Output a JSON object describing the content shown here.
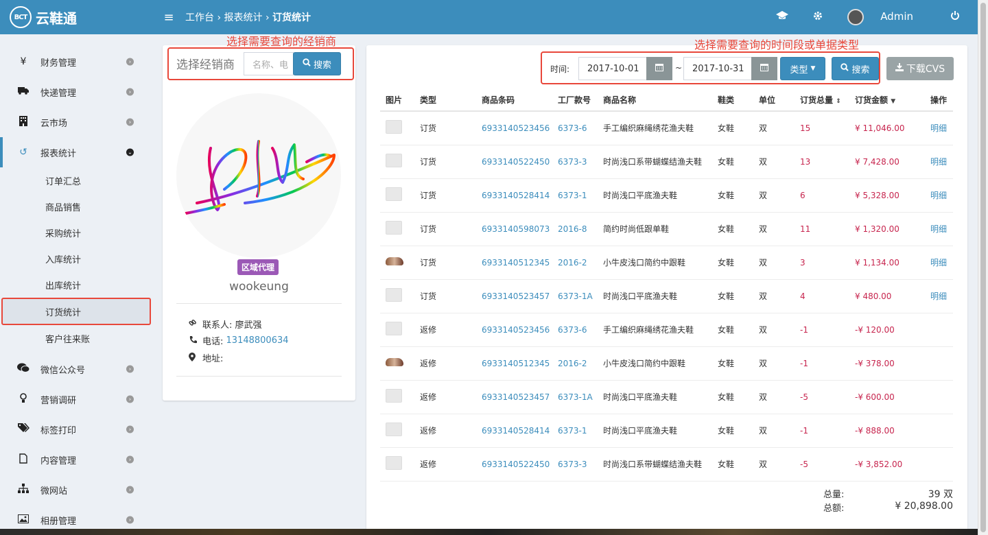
{
  "app": {
    "logo_text": "BCT",
    "name": "云鞋通"
  },
  "topbar": {
    "breadcrumb": [
      "工作台",
      "报表统计",
      "订货统计"
    ],
    "user": "Admin"
  },
  "sidebar": {
    "items": [
      {
        "label": "财务管理",
        "icon": "yen-icon"
      },
      {
        "label": "快递管理",
        "icon": "truck-icon"
      },
      {
        "label": "云市场",
        "icon": "building-icon"
      },
      {
        "label": "报表统计",
        "icon": "history-icon"
      }
    ],
    "sub_items": [
      "订单汇总",
      "商品销售",
      "采购统计",
      "入库统计",
      "出库统计",
      "订货统计",
      "客户往来账"
    ],
    "lower_items": [
      {
        "label": "微信公众号",
        "icon": "wechat-icon"
      },
      {
        "label": "营销调研",
        "icon": "bulb-icon"
      },
      {
        "label": "标签打印",
        "icon": "tags-icon"
      },
      {
        "label": "内容管理",
        "icon": "file-icon"
      },
      {
        "label": "微网站",
        "icon": "sitemap-icon"
      },
      {
        "label": "相册管理",
        "icon": "image-icon"
      }
    ]
  },
  "annotations": {
    "left": "选择需要查询的经销商",
    "right": "选择需要查询的时间段或单据类型"
  },
  "dealer": {
    "label": "选择经销商",
    "search_placeholder": "名称、电",
    "search_button": "搜索",
    "badge": "区域代理",
    "name": "wookeung",
    "contact_label": "联系人:",
    "contact": "廖武强",
    "phone_label": "电话:",
    "phone": "13148800634",
    "address_label": "地址:"
  },
  "filters": {
    "time_label": "时间:",
    "date_from": "2017-10-01",
    "sep": "~",
    "date_to": "2017-10-31",
    "type_button": "类型",
    "search_button": "搜索",
    "download_button": "下载CVS"
  },
  "table": {
    "headers": [
      "图片",
      "类型",
      "商品条码",
      "工厂款号",
      "商品名称",
      "鞋类",
      "单位",
      "订货总量",
      "订货金额",
      "操作"
    ],
    "rows": [
      {
        "img": "placeholder",
        "type": "订货",
        "barcode": "6933140523456",
        "style": "6373-6",
        "name": "手工编织麻绳绣花渔夫鞋",
        "category": "女鞋",
        "unit": "双",
        "qty": "15",
        "amount": "¥ 11,046.00",
        "op": "明细"
      },
      {
        "img": "placeholder",
        "type": "订货",
        "barcode": "6933140522450",
        "style": "6373-3",
        "name": "时尚浅口系带蝴蝶结渔夫鞋",
        "category": "女鞋",
        "unit": "双",
        "qty": "13",
        "amount": "¥ 7,428.00",
        "op": "明细"
      },
      {
        "img": "placeholder",
        "type": "订货",
        "barcode": "6933140528414",
        "style": "6373-1",
        "name": "时尚浅口平底渔夫鞋",
        "category": "女鞋",
        "unit": "双",
        "qty": "6",
        "amount": "¥ 5,328.00",
        "op": "明细"
      },
      {
        "img": "placeholder",
        "type": "订货",
        "barcode": "6933140598073",
        "style": "2016-8",
        "name": "简约时尚低跟单鞋",
        "category": "女鞋",
        "unit": "双",
        "qty": "11",
        "amount": "¥ 1,320.00",
        "op": "明细"
      },
      {
        "img": "shoe",
        "type": "订货",
        "barcode": "6933140512345",
        "style": "2016-2",
        "name": "小牛皮浅口简约中跟鞋",
        "category": "女鞋",
        "unit": "双",
        "qty": "3",
        "amount": "¥ 1,134.00",
        "op": "明细"
      },
      {
        "img": "placeholder",
        "type": "订货",
        "barcode": "6933140523457",
        "style": "6373-1A",
        "name": "时尚浅口平底渔夫鞋",
        "category": "女鞋",
        "unit": "双",
        "qty": "4",
        "amount": "¥ 480.00",
        "op": "明细"
      },
      {
        "img": "placeholder",
        "type": "返修",
        "barcode": "6933140523456",
        "style": "6373-6",
        "name": "手工编织麻绳绣花渔夫鞋",
        "category": "女鞋",
        "unit": "双",
        "qty": "-1",
        "amount": "-¥ 120.00",
        "op": ""
      },
      {
        "img": "shoe",
        "type": "返修",
        "barcode": "6933140512345",
        "style": "2016-2",
        "name": "小牛皮浅口简约中跟鞋",
        "category": "女鞋",
        "unit": "双",
        "qty": "-1",
        "amount": "-¥ 378.00",
        "op": ""
      },
      {
        "img": "placeholder",
        "type": "返修",
        "barcode": "6933140523457",
        "style": "6373-1A",
        "name": "时尚浅口平底渔夫鞋",
        "category": "女鞋",
        "unit": "双",
        "qty": "-5",
        "amount": "-¥ 600.00",
        "op": ""
      },
      {
        "img": "placeholder",
        "type": "返修",
        "barcode": "6933140528414",
        "style": "6373-1",
        "name": "时尚浅口平底渔夫鞋",
        "category": "女鞋",
        "unit": "双",
        "qty": "-1",
        "amount": "-¥ 888.00",
        "op": ""
      },
      {
        "img": "placeholder",
        "type": "返修",
        "barcode": "6933140522450",
        "style": "6373-3",
        "name": "时尚浅口系带蝴蝶结渔夫鞋",
        "category": "女鞋",
        "unit": "双",
        "qty": "-5",
        "amount": "-¥ 3,852.00",
        "op": ""
      }
    ]
  },
  "totals": {
    "qty_label": "总量:",
    "qty": "39 双",
    "amount_label": "总额:",
    "amount": "¥ 20,898.00"
  },
  "colors": {
    "primary": "#3c8dbc",
    "annotation": "#e8473a",
    "badge": "#9b59b6",
    "negative": "#c7254e"
  }
}
